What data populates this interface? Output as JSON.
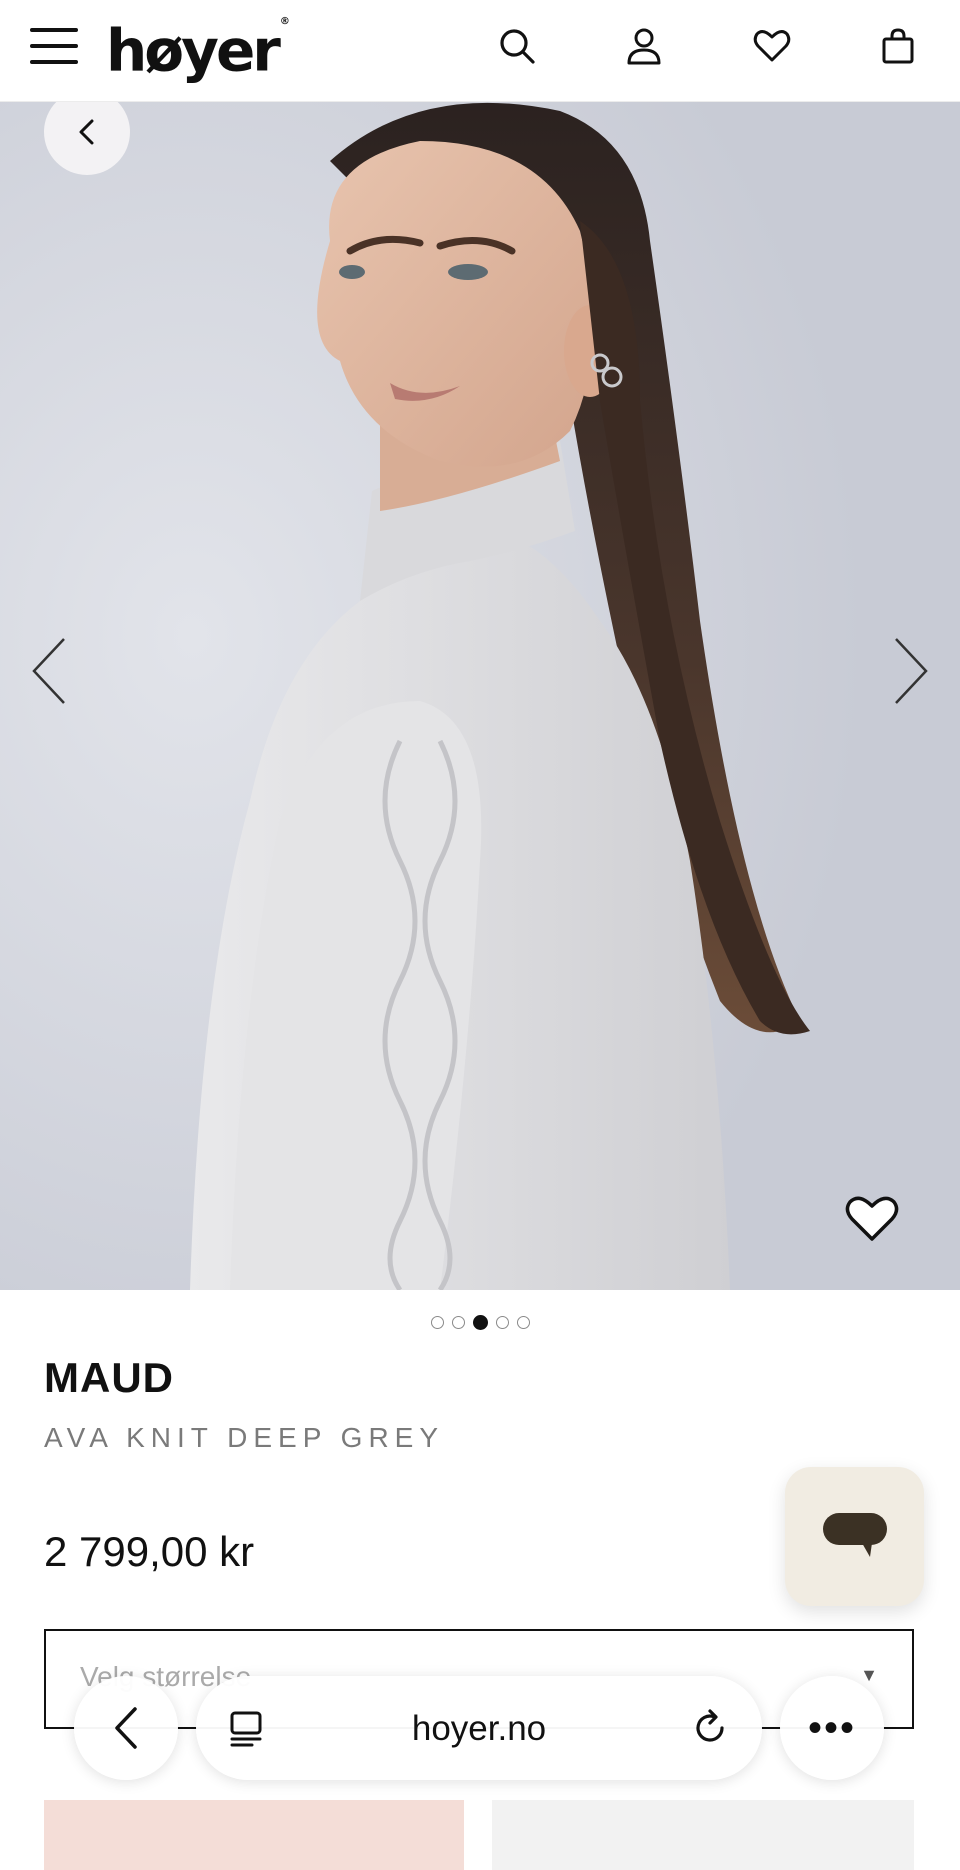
{
  "header": {
    "logo_text": "høyer",
    "logo_mark": "®",
    "icons": [
      "menu-icon",
      "search-icon",
      "user-icon",
      "heart-icon",
      "bag-icon"
    ]
  },
  "gallery": {
    "total_images": 5,
    "active_index": 2
  },
  "product": {
    "brand": "MAUD",
    "name": "AVA KNIT DEEP GREY",
    "price": "2 799,00 kr",
    "size_placeholder": "Velg størrelse"
  },
  "browser": {
    "url": "hoyer.no",
    "more_label": "•••"
  },
  "colors": {
    "accent_pink": "#f4ddd7",
    "chat_bg": "#f1ece2",
    "chat_icon": "#3b3124"
  }
}
